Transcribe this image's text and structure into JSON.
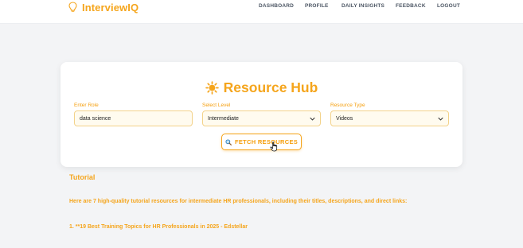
{
  "app": {
    "name": "InterviewIQ",
    "accent_color": "#f5a51c",
    "brand_icon": "lightbulb-icon"
  },
  "nav": {
    "links": [
      "DASHBOARD",
      "PROFILE",
      "DAILY INSIGHTS",
      "FEEDBACK",
      "LOGOUT"
    ]
  },
  "resource_hub": {
    "title": "Resource Hub",
    "title_icon": "sun-icon",
    "role_label": "Enter Role",
    "role_value": "data science",
    "level_label": "Select Level",
    "level_value": "Intermediate",
    "type_label": "Resource Type",
    "type_value": "Videos",
    "fetch_label": "FETCH RESOURCES",
    "fetch_icon": "magnifier-icon"
  },
  "results": {
    "section_title": "Tutorial",
    "intro": "Here are 7 high-quality tutorial resources for intermediate HR professionals, including their titles, descriptions, and direct links:",
    "items": [
      "1. **19 Best Training Topics for HR Professionals in 2025 - Edstellar"
    ]
  }
}
